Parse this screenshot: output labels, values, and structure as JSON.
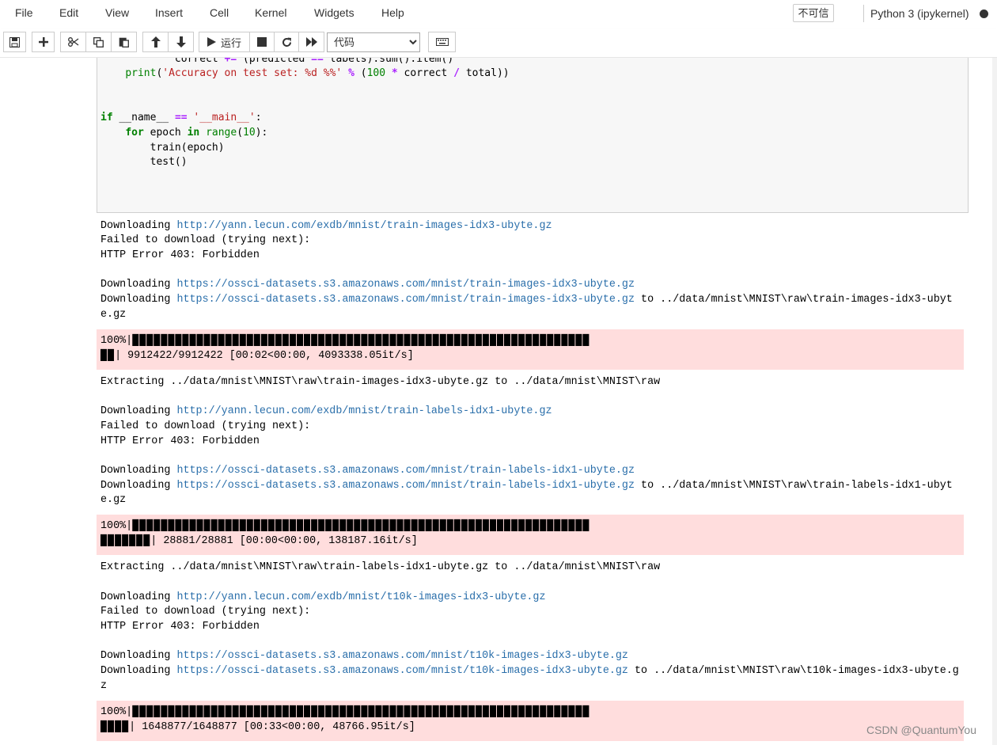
{
  "menu": {
    "items": [
      "File",
      "Edit",
      "View",
      "Insert",
      "Cell",
      "Kernel",
      "Widgets",
      "Help"
    ],
    "trust_label": "不可信",
    "kernel_name": "Python 3 (ipykernel)"
  },
  "toolbar": {
    "run_label": "运行",
    "cell_type_value": "代码",
    "icons": [
      "save-icon",
      "plus-icon",
      "cut-icon",
      "copy-icon",
      "paste-icon",
      "arrow-up-icon",
      "arrow-down-icon",
      "play-icon",
      "stop-icon",
      "restart-icon",
      "fast-forward-icon",
      "keyboard-icon"
    ]
  },
  "code": {
    "line1_indent": "            ",
    "line1_a": "correct",
    "line1_op": "+=",
    "line1_b": "(predicted",
    "line1_eq": "==",
    "line1_c": "labels).sum().item()",
    "line2_indent": "    ",
    "line2_print": "print",
    "line2_str": "'Accuracy on test set: %d %%'",
    "line2_mod": "%",
    "line2_num": "100",
    "line2_star": "*",
    "line2_correct": "correct",
    "line2_div": "/",
    "line2_rest": "total))",
    "line3_if": "if",
    "line3_name": "__name__",
    "line3_eq": "==",
    "line3_str": "'__main__'",
    "line4_for": "for",
    "line4_var": "epoch",
    "line4_in": "in",
    "line4_range": "range",
    "line4_num": "10",
    "line5": "train(epoch)",
    "line6": "test()"
  },
  "output": {
    "dl_prefix": "Downloading ",
    "fail": "Failed to download (trying next):",
    "http403": "HTTP Error 403: Forbidden",
    "block1": {
      "url1": "http://yann.lecun.com/exdb/mnist/train-images-idx3-ubyte.gz",
      "url2": "https://ossci-datasets.s3.amazonaws.com/mnist/train-images-idx3-ubyte.gz",
      "to": " to ../data/mnist\\MNIST\\raw\\train-images-idx3-ubyt",
      "wrap": "e.gz",
      "pbar_head": "100%|",
      "pbar_blocks1": "████████████████████████████████████████████████████████████████",
      "pbar_blocks2": "██",
      "pbar_tail": "| 9912422/9912422 [00:02<00:00, 4093338.05it/s]",
      "extract": "Extracting ../data/mnist\\MNIST\\raw\\train-images-idx3-ubyte.gz to ../data/mnist\\MNIST\\raw"
    },
    "block2": {
      "url1": "http://yann.lecun.com/exdb/mnist/train-labels-idx1-ubyte.gz",
      "url2": "https://ossci-datasets.s3.amazonaws.com/mnist/train-labels-idx1-ubyte.gz",
      "to": " to ../data/mnist\\MNIST\\raw\\train-labels-idx1-ubyt",
      "wrap": "e.gz",
      "pbar_head": "100%|",
      "pbar_blocks1": "████████████████████████████████████████████████████████████████",
      "pbar_blocks2": "███████",
      "pbar_tail": "| 28881/28881 [00:00<00:00, 138187.16it/s]",
      "extract": "Extracting ../data/mnist\\MNIST\\raw\\train-labels-idx1-ubyte.gz to ../data/mnist\\MNIST\\raw"
    },
    "block3": {
      "url1": "http://yann.lecun.com/exdb/mnist/t10k-images-idx3-ubyte.gz",
      "url2": "https://ossci-datasets.s3.amazonaws.com/mnist/t10k-images-idx3-ubyte.gz",
      "to": " to ../data/mnist\\MNIST\\raw\\t10k-images-idx3-ubyte.g",
      "wrap": "z",
      "pbar_head": "100%|",
      "pbar_blocks1": "████████████████████████████████████████████████████████████████",
      "pbar_blocks2": "████",
      "pbar_tail": "| 1648877/1648877 [00:33<00:00, 48766.95it/s]"
    }
  },
  "watermark": "CSDN @QuantumYou"
}
